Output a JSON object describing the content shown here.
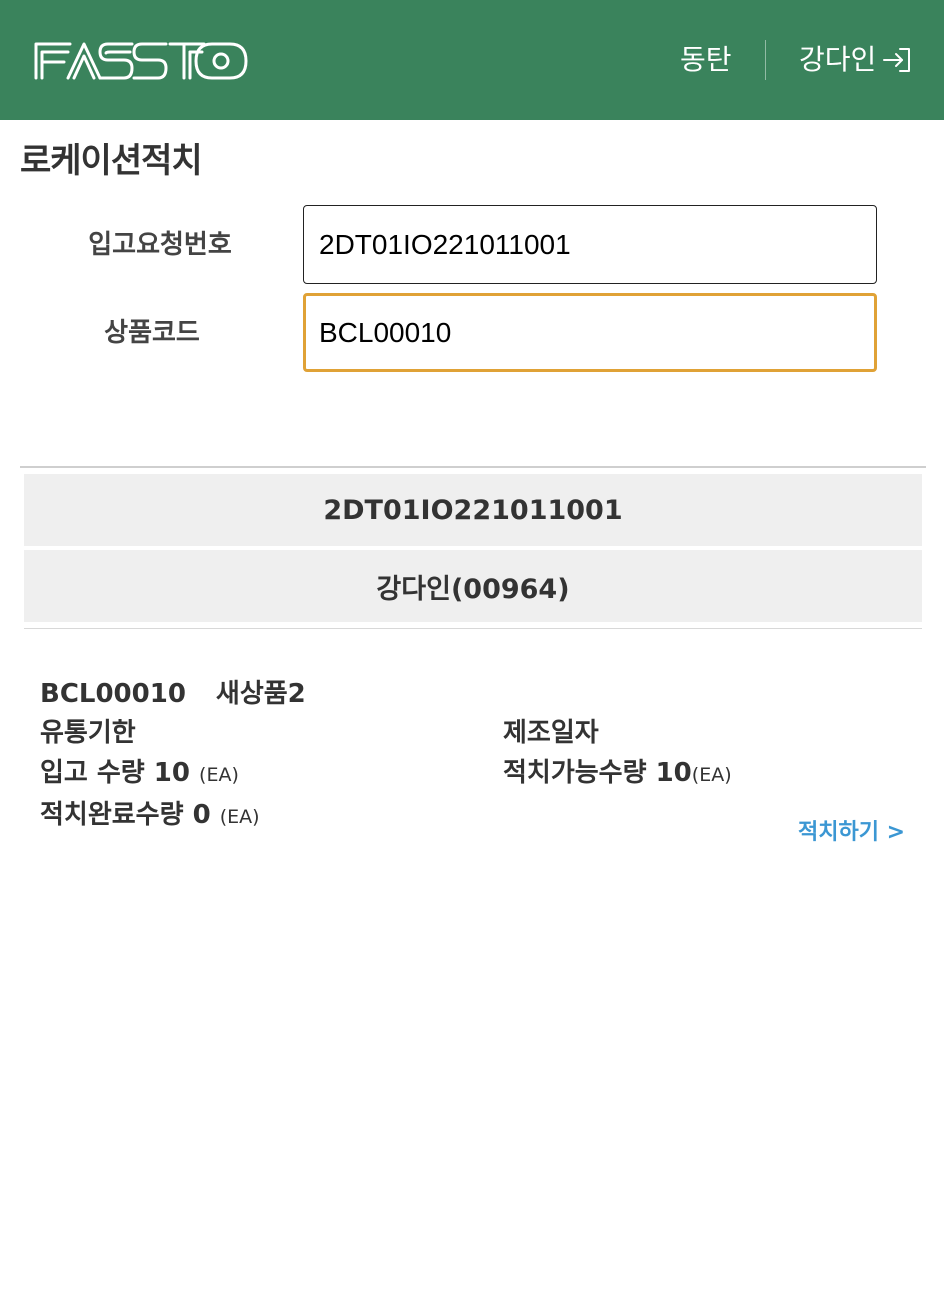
{
  "header": {
    "logo_text": "FASSTO",
    "warehouse": "동탄",
    "user_name": "강다인",
    "logout_icon": "logout-icon",
    "colors": {
      "background": "#3a835c",
      "text": "#ffffff"
    }
  },
  "page": {
    "title": "로케이션적치"
  },
  "form": {
    "request_no_label": "입고요청번호",
    "request_no_value": "2DT01IO221011001",
    "product_code_label": "상품코드",
    "product_code_value": "BCL00010",
    "focus_color": "#e0a236"
  },
  "summary": {
    "request_no": "2DT01IO221011001",
    "worker": "강다인(00964)"
  },
  "item": {
    "code": "BCL00010",
    "name": "새상품2",
    "expiry_label": "유통기한",
    "mfg_date_label": "제조일자",
    "inbound_qty_label": "입고 수량",
    "inbound_qty": "10",
    "available_qty_label": "적치가능수량",
    "available_qty": "10",
    "completed_qty_label": "적치완료수량",
    "completed_qty": "0",
    "unit": "(EA)",
    "action_label": "적치하기 >",
    "action_color": "#3b97d3"
  }
}
